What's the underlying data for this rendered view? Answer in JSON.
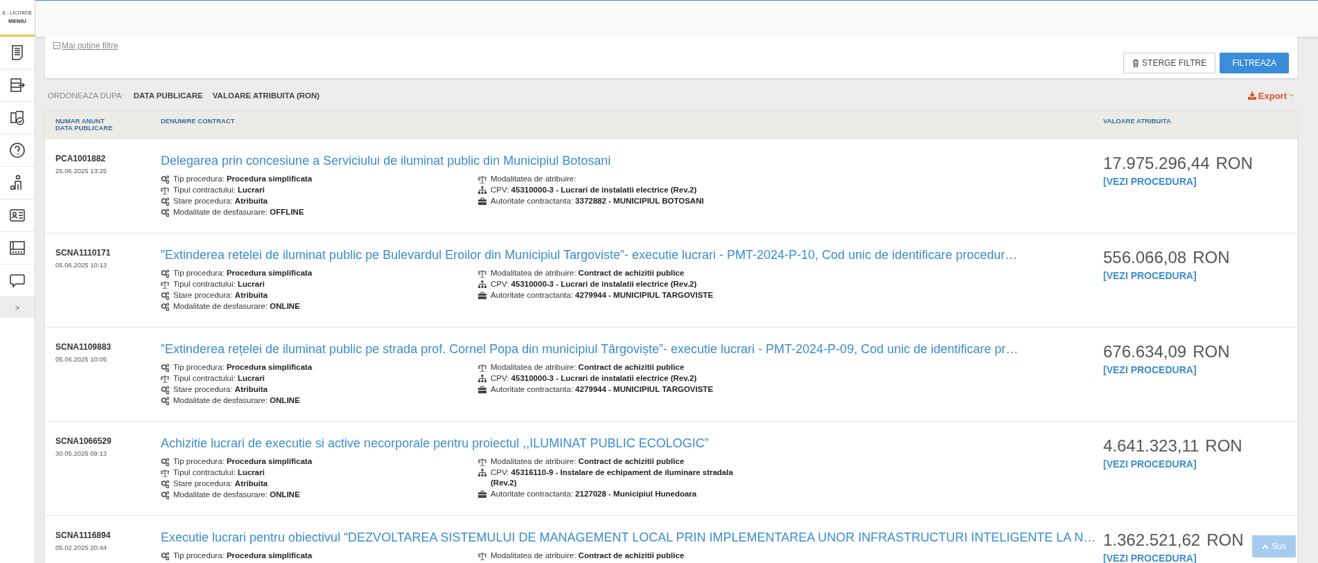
{
  "sidebar": {
    "brand": "E - LICITATIE",
    "menu_label": "MENIU",
    "items": [
      {
        "selected": false
      },
      {
        "selected": false
      },
      {
        "selected": false
      },
      {
        "selected": false
      },
      {
        "selected": false
      },
      {
        "selected": false
      },
      {
        "selected": false
      },
      {
        "selected": false
      }
    ],
    "collapse": ">"
  },
  "filters": {
    "toggle": "Mai putine filtre",
    "clear_button": "STERGE FILTRE",
    "filter_button": "FILTREAZA"
  },
  "sort": {
    "label": "ORDONEAZA DUPA:",
    "options": [
      "DATA PUBLICARE",
      "VALOARE ATRIBUITA (RON)"
    ]
  },
  "export": "Export",
  "table": {
    "columns": [
      [
        "NUMAR ANUNT",
        "DATA PUBLICARE"
      ],
      [
        "DENUMIRE CONTRACT"
      ],
      [
        "VALOARE ATRIBUITA"
      ]
    ],
    "rows": [
      {
        "number": "PCA1001882",
        "date": "25.06.2025 13:25",
        "title": "Delegarea prin concesiune a Serviciului de iluminat public din Municipiul Botosani",
        "left": [
          {
            "label": "Tip procedura:",
            "value": "Procedura simplificata"
          },
          {
            "label": "Tipul contractului:",
            "value": "Lucrari"
          },
          {
            "label": "Stare procedura:",
            "value": "Atribuita"
          },
          {
            "label": "Modalitate de desfasurare:",
            "value": "OFFLINE"
          }
        ],
        "right": [
          {
            "label": "Modalitatea de atribuire:"
          },
          {
            "label": "CPV:",
            "value": "45310000-3 - Lucrari de instalatii electrice (Rev.2)"
          },
          {
            "label": "Autoritate contractanta:",
            "value": "3372882 - MUNICIPIUL BOTOSANI"
          }
        ],
        "amount": "17.975.296,44",
        "currency": "RON",
        "link": "[VEZI PROCEDURA]"
      },
      {
        "number": "SCNA1110171",
        "date": "05.06.2025 10:13",
        "title": "”Extinderea retelei de iluminat public pe Bulevardul Eroilor din Municipiul Targoviste”- executie lucrari - PMT-2024-P-10, Cod unic de identificare procedur…",
        "left": [
          {
            "label": "Tip procedura:",
            "value": "Procedura simplificata"
          },
          {
            "label": "Tipul contractului:",
            "value": "Lucrari"
          },
          {
            "label": "Stare procedura:",
            "value": "Atribuita"
          },
          {
            "label": "Modalitate de desfasurare:",
            "value": "ONLINE"
          }
        ],
        "right": [
          {
            "label": "Modalitatea de atribuire:",
            "value": "Contract de achizitii publice"
          },
          {
            "label": "CPV:",
            "value": "45310000-3 - Lucrari de instalatii electrice (Rev.2)"
          },
          {
            "label": "Autoritate contractanta:",
            "value": "4279944 - MUNICIPIUL TARGOVISTE"
          }
        ],
        "amount": "556.066,08",
        "currency": "RON",
        "link": "[VEZI PROCEDURA]"
      },
      {
        "number": "SCNA1109883",
        "date": "05.06.2025 10:05",
        "title": "”Extinderea rețelei de iluminat public pe strada prof. Cornel Popa din municipiul Târgoviște”- executie lucrari - PMT-2024-P-09, Cod unic de identificare pr…",
        "left": [
          {
            "label": "Tip procedura:",
            "value": "Procedura simplificata"
          },
          {
            "label": "Tipul contractului:",
            "value": "Lucrari"
          },
          {
            "label": "Stare procedura:",
            "value": "Atribuita"
          },
          {
            "label": "Modalitate de desfasurare:",
            "value": "ONLINE"
          }
        ],
        "right": [
          {
            "label": "Modalitatea de atribuire:",
            "value": "Contract de achizitii publice"
          },
          {
            "label": "CPV:",
            "value": "45310000-3 - Lucrari de instalatii electrice (Rev.2)"
          },
          {
            "label": "Autoritate contractanta:",
            "value": "4279944 - MUNICIPIUL TARGOVISTE"
          }
        ],
        "amount": "676.634,09",
        "currency": "RON",
        "link": "[VEZI PROCEDURA]"
      },
      {
        "number": "SCNA1066529",
        "date": "30.05.2025 09:13",
        "title": "Achizitie lucrari de executie si active necorporale pentru proiectul ,,ILUMINAT PUBLIC ECOLOGIC”",
        "left": [
          {
            "label": "Tip procedura:",
            "value": "Procedura simplificata"
          },
          {
            "label": "Tipul contractului:",
            "value": "Lucrari"
          },
          {
            "label": "Stare procedura:",
            "value": "Atribuita"
          },
          {
            "label": "Modalitate de desfasurare:",
            "value": "ONLINE"
          }
        ],
        "right": [
          {
            "label": "Modalitatea de atribuire:",
            "value": "Contract de achizitii publice"
          },
          {
            "label": "CPV:",
            "value": "45316110-9 - Instalare de echipament de iluminare stradala (Rev.2)"
          },
          {
            "label": "Autoritate contractanta:",
            "value": "2127028 - Municipiul Hunedoara"
          }
        ],
        "amount": "4.641.323,11",
        "currency": "RON",
        "link": "[VEZI PROCEDURA]"
      },
      {
        "number": "SCNA1116894",
        "date": "05.02.2025 20:44",
        "title": "Executie lucrari pentru obiectivul “DEZVOLTAREA SISTEMULUI DE MANAGEMENT LOCAL PRIN IMPLEMENTAREA UNOR INFRASTRUCTURI INTELIGENTE LA N…",
        "left": [
          {
            "label": "Tip procedura:",
            "value": "Procedura simplificata"
          }
        ],
        "right": [
          {
            "label": "Modalitatea de atribuire:",
            "value": "Contract de achizitii publice"
          }
        ],
        "amount": "1.362.521,62",
        "currency": "RON",
        "link": "[VEZI PROCEDURA]"
      }
    ]
  },
  "back_to_top": "Sus"
}
